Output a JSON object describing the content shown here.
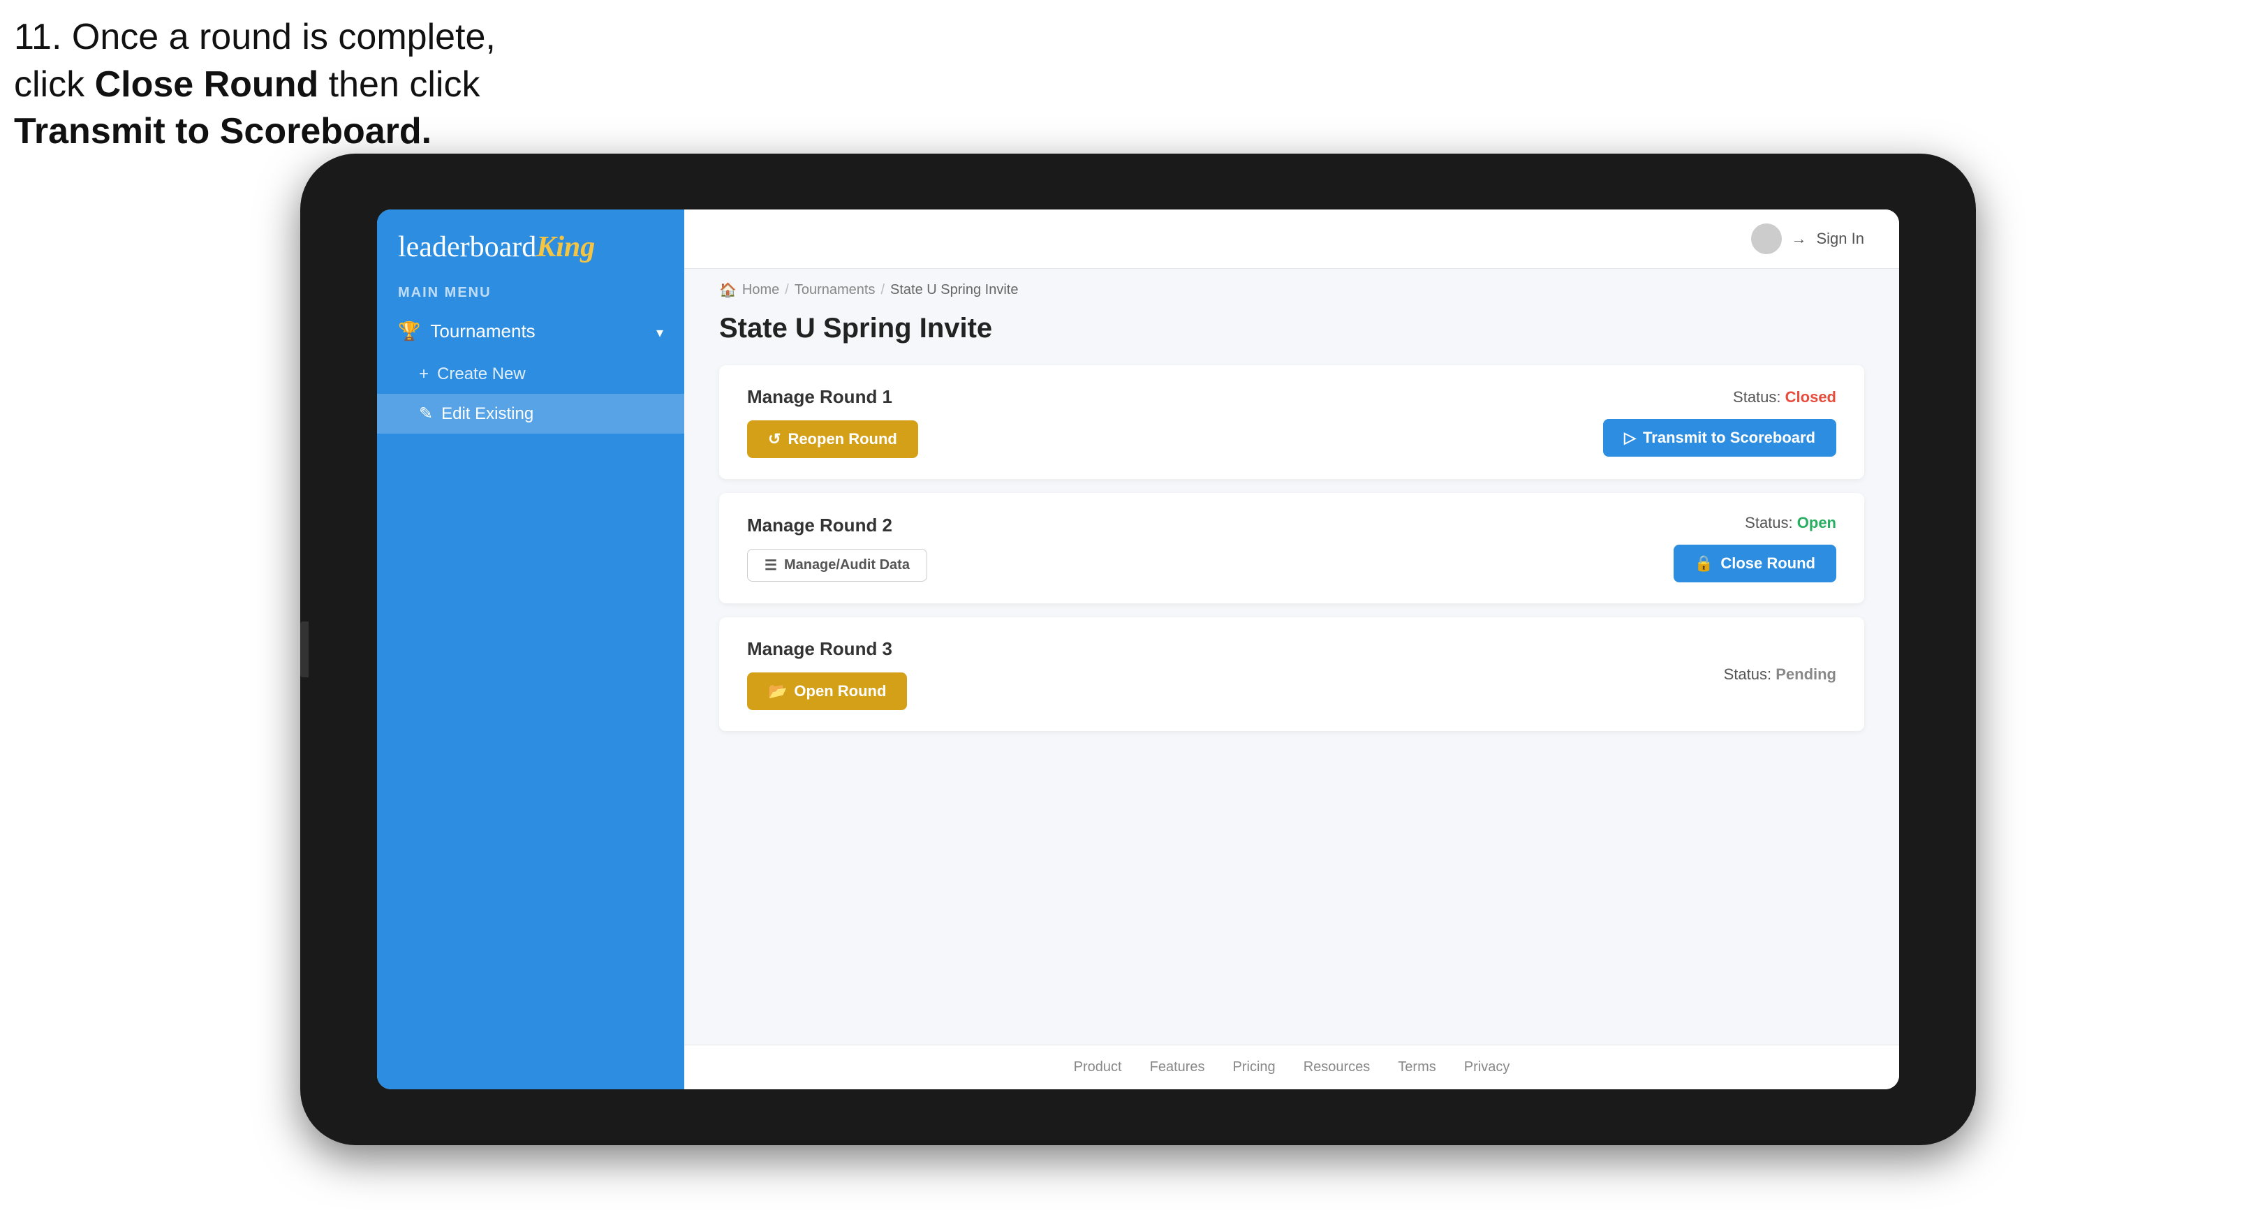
{
  "instruction": {
    "line1": "11. Once a round is complete,",
    "line2": "click ",
    "bold1": "Close Round",
    "line3": " then click",
    "bold2": "Transmit to Scoreboard."
  },
  "header": {
    "sign_in": "Sign In",
    "avatar_alt": "user avatar"
  },
  "breadcrumb": {
    "home": "Home",
    "tournaments": "Tournaments",
    "current": "State U Spring Invite"
  },
  "page": {
    "title": "State U Spring Invite",
    "main_menu_label": "MAIN MENU"
  },
  "sidebar": {
    "logo": "leaderboard",
    "logo_king": "King",
    "nav_items": [
      {
        "label": "Tournaments",
        "icon": "trophy"
      }
    ],
    "sub_items": [
      {
        "label": "Create New",
        "prefix": "+"
      },
      {
        "label": "Edit Existing",
        "prefix": "✎",
        "active": true
      }
    ]
  },
  "rounds": [
    {
      "label": "Manage Round 1",
      "status_label": "Status:",
      "status_value": "Closed",
      "status_type": "closed",
      "buttons": [
        {
          "label": "Reopen Round",
          "type": "gold",
          "icon": "↺"
        }
      ],
      "right_buttons": [
        {
          "label": "Transmit to Scoreboard",
          "type": "blue",
          "icon": "▷"
        }
      ]
    },
    {
      "label": "Manage Round 2",
      "status_label": "Status:",
      "status_value": "Open",
      "status_type": "open",
      "buttons": [
        {
          "label": "Manage/Audit Data",
          "type": "outline",
          "icon": "☰"
        }
      ],
      "right_buttons": [
        {
          "label": "Close Round",
          "type": "blue",
          "icon": "🔒"
        }
      ]
    },
    {
      "label": "Manage Round 3",
      "status_label": "Status:",
      "status_value": "Pending",
      "status_type": "pending",
      "buttons": [
        {
          "label": "Open Round",
          "type": "gold",
          "icon": "📂"
        }
      ],
      "right_buttons": []
    }
  ],
  "footer": {
    "links": [
      "Product",
      "Features",
      "Pricing",
      "Resources",
      "Terms",
      "Privacy"
    ]
  }
}
